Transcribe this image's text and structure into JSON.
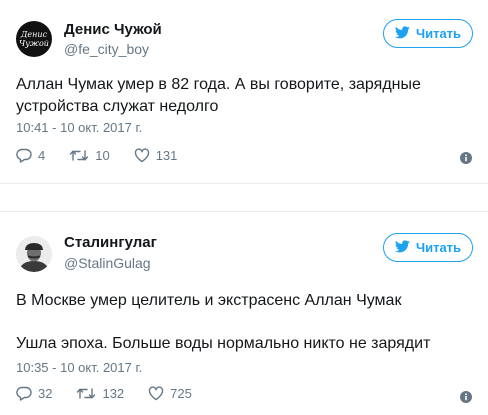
{
  "tweets": [
    {
      "name": "Денис Чужой",
      "handle": "@fe_city_boy",
      "avatar_text": [
        "Денис",
        "Чужой"
      ],
      "follow_label": "Читать",
      "text": "Аллан Чумак умер в 82 года. А вы говорите, зарядные устройства служат недолго",
      "time": "10:41 - 10 окт. 2017 г.",
      "replies": "4",
      "retweets": "10",
      "likes": "131"
    },
    {
      "name": "Сталингулаг",
      "handle": "@StalinGulag",
      "follow_label": "Читать",
      "text_1": "В Москве умер целитель и экстрасенс Аллан Чумак",
      "text_2": "Ушла эпоха. Больше воды нормально никто не зарядит",
      "time": "10:35 - 10 окт. 2017 г.",
      "replies": "32",
      "retweets": "132",
      "likes": "725"
    }
  ],
  "colors": {
    "accent": "#1da1f2",
    "secondary_text": "#657786",
    "primary_text": "#14171a",
    "divider": "#e6ecf0"
  },
  "icons": [
    "twitter-bird-icon",
    "reply-icon",
    "retweet-icon",
    "like-icon",
    "info-icon"
  ]
}
